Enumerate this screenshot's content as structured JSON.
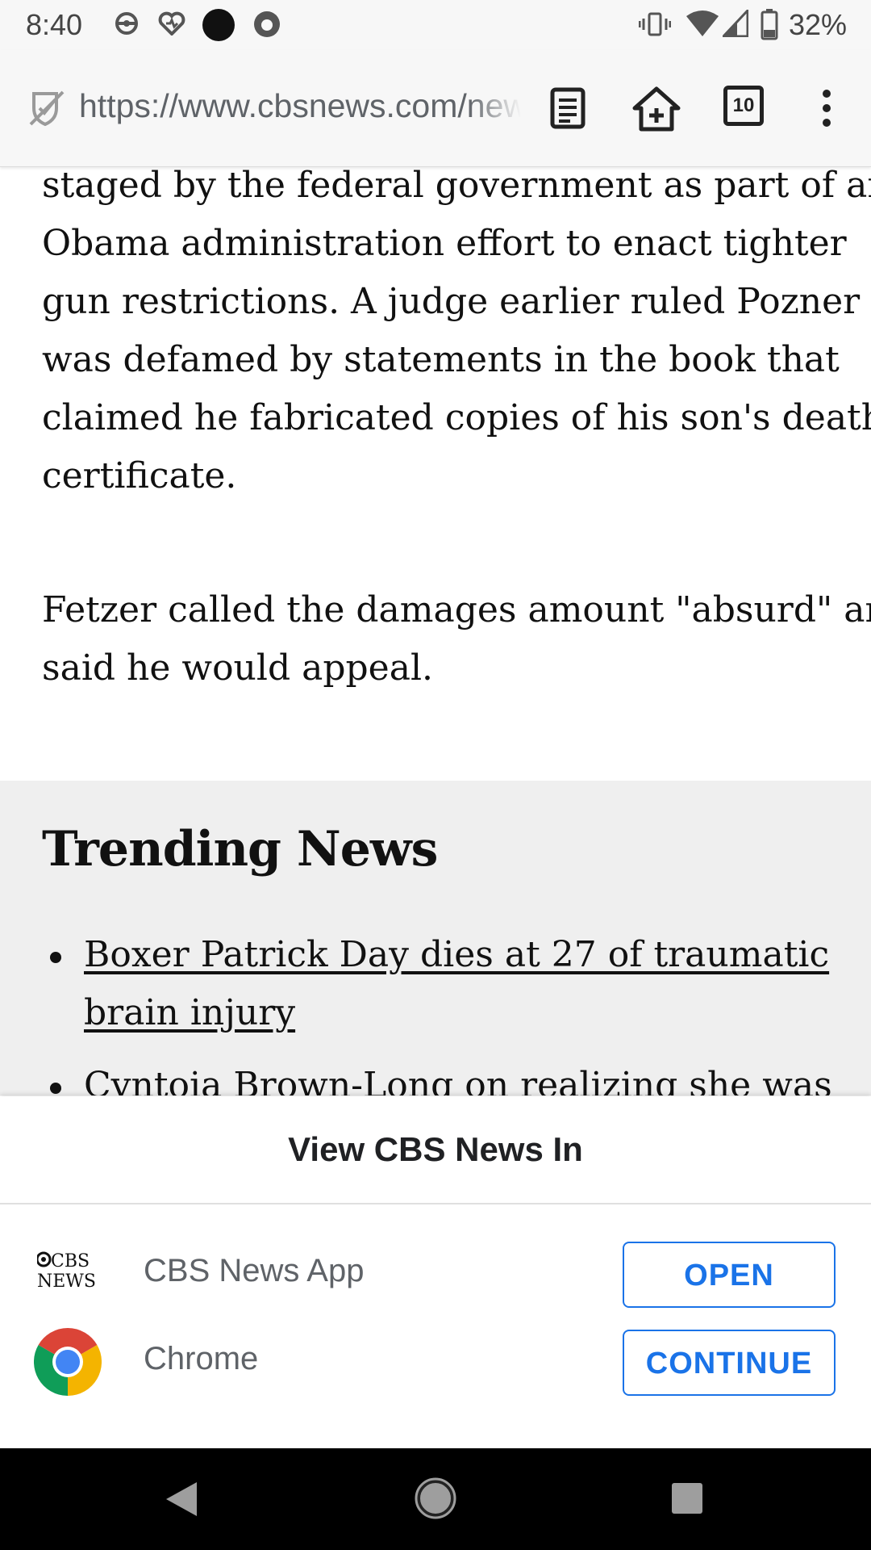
{
  "status_bar": {
    "time": "8:40",
    "battery": "32%",
    "icons": [
      "pokeball-icon",
      "heart-icon",
      "dot-icon",
      "firefox-icon",
      "vibrate-icon",
      "wifi-icon",
      "signal-icon",
      "battery-icon"
    ]
  },
  "browser": {
    "url": "https://www.cbsnews.com/news",
    "tab_count": "10"
  },
  "article": {
    "paragraph_1": "staged by the federal government as part of an Obama administration effort to enact tighter gun restrictions. A judge earlier ruled Pozner was defamed by statements in the book that claimed he fabricated copies of his son's death certificate.",
    "paragraph_2": "Fetzer called the damages amount \"absurd\" and said he would appeal."
  },
  "trending": {
    "title": "Trending News",
    "items": [
      "Boxer Patrick Day dies at 27 of traumatic brain injury",
      "Cyntoia Brown-Long on realizing she was"
    ]
  },
  "sheet": {
    "title": "View CBS News In",
    "apps": [
      {
        "label": "CBS News App",
        "action": "OPEN",
        "logo_text": "CBS NEWS"
      },
      {
        "label": "Chrome",
        "action": "CONTINUE"
      }
    ]
  },
  "colors": {
    "accent": "#1a73e8",
    "trending_bg": "#efefef",
    "chrome_red": "#db4437",
    "chrome_yellow": "#f4b400",
    "chrome_green": "#0f9d58",
    "chrome_blue": "#4285f4"
  }
}
